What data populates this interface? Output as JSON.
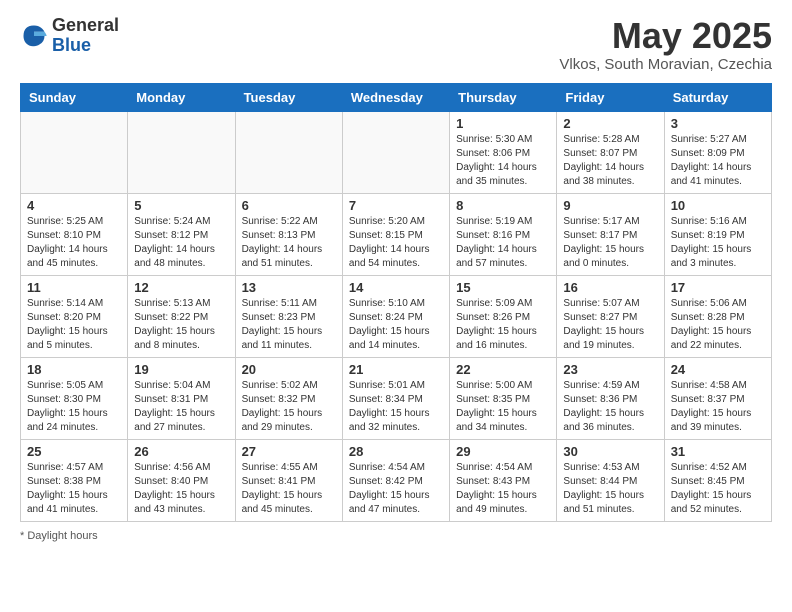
{
  "header": {
    "logo_general": "General",
    "logo_blue": "Blue",
    "month_title": "May 2025",
    "subtitle": "Vlkos, South Moravian, Czechia"
  },
  "days_of_week": [
    "Sunday",
    "Monday",
    "Tuesday",
    "Wednesday",
    "Thursday",
    "Friday",
    "Saturday"
  ],
  "weeks": [
    [
      {
        "day": "",
        "sunrise": "",
        "sunset": "",
        "daylight": "",
        "empty": true
      },
      {
        "day": "",
        "sunrise": "",
        "sunset": "",
        "daylight": "",
        "empty": true
      },
      {
        "day": "",
        "sunrise": "",
        "sunset": "",
        "daylight": "",
        "empty": true
      },
      {
        "day": "",
        "sunrise": "",
        "sunset": "",
        "daylight": "",
        "empty": true
      },
      {
        "day": "1",
        "sunrise": "Sunrise: 5:30 AM",
        "sunset": "Sunset: 8:06 PM",
        "daylight": "Daylight: 14 hours and 35 minutes."
      },
      {
        "day": "2",
        "sunrise": "Sunrise: 5:28 AM",
        "sunset": "Sunset: 8:07 PM",
        "daylight": "Daylight: 14 hours and 38 minutes."
      },
      {
        "day": "3",
        "sunrise": "Sunrise: 5:27 AM",
        "sunset": "Sunset: 8:09 PM",
        "daylight": "Daylight: 14 hours and 41 minutes."
      }
    ],
    [
      {
        "day": "4",
        "sunrise": "Sunrise: 5:25 AM",
        "sunset": "Sunset: 8:10 PM",
        "daylight": "Daylight: 14 hours and 45 minutes."
      },
      {
        "day": "5",
        "sunrise": "Sunrise: 5:24 AM",
        "sunset": "Sunset: 8:12 PM",
        "daylight": "Daylight: 14 hours and 48 minutes."
      },
      {
        "day": "6",
        "sunrise": "Sunrise: 5:22 AM",
        "sunset": "Sunset: 8:13 PM",
        "daylight": "Daylight: 14 hours and 51 minutes."
      },
      {
        "day": "7",
        "sunrise": "Sunrise: 5:20 AM",
        "sunset": "Sunset: 8:15 PM",
        "daylight": "Daylight: 14 hours and 54 minutes."
      },
      {
        "day": "8",
        "sunrise": "Sunrise: 5:19 AM",
        "sunset": "Sunset: 8:16 PM",
        "daylight": "Daylight: 14 hours and 57 minutes."
      },
      {
        "day": "9",
        "sunrise": "Sunrise: 5:17 AM",
        "sunset": "Sunset: 8:17 PM",
        "daylight": "Daylight: 15 hours and 0 minutes."
      },
      {
        "day": "10",
        "sunrise": "Sunrise: 5:16 AM",
        "sunset": "Sunset: 8:19 PM",
        "daylight": "Daylight: 15 hours and 3 minutes."
      }
    ],
    [
      {
        "day": "11",
        "sunrise": "Sunrise: 5:14 AM",
        "sunset": "Sunset: 8:20 PM",
        "daylight": "Daylight: 15 hours and 5 minutes."
      },
      {
        "day": "12",
        "sunrise": "Sunrise: 5:13 AM",
        "sunset": "Sunset: 8:22 PM",
        "daylight": "Daylight: 15 hours and 8 minutes."
      },
      {
        "day": "13",
        "sunrise": "Sunrise: 5:11 AM",
        "sunset": "Sunset: 8:23 PM",
        "daylight": "Daylight: 15 hours and 11 minutes."
      },
      {
        "day": "14",
        "sunrise": "Sunrise: 5:10 AM",
        "sunset": "Sunset: 8:24 PM",
        "daylight": "Daylight: 15 hours and 14 minutes."
      },
      {
        "day": "15",
        "sunrise": "Sunrise: 5:09 AM",
        "sunset": "Sunset: 8:26 PM",
        "daylight": "Daylight: 15 hours and 16 minutes."
      },
      {
        "day": "16",
        "sunrise": "Sunrise: 5:07 AM",
        "sunset": "Sunset: 8:27 PM",
        "daylight": "Daylight: 15 hours and 19 minutes."
      },
      {
        "day": "17",
        "sunrise": "Sunrise: 5:06 AM",
        "sunset": "Sunset: 8:28 PM",
        "daylight": "Daylight: 15 hours and 22 minutes."
      }
    ],
    [
      {
        "day": "18",
        "sunrise": "Sunrise: 5:05 AM",
        "sunset": "Sunset: 8:30 PM",
        "daylight": "Daylight: 15 hours and 24 minutes."
      },
      {
        "day": "19",
        "sunrise": "Sunrise: 5:04 AM",
        "sunset": "Sunset: 8:31 PM",
        "daylight": "Daylight: 15 hours and 27 minutes."
      },
      {
        "day": "20",
        "sunrise": "Sunrise: 5:02 AM",
        "sunset": "Sunset: 8:32 PM",
        "daylight": "Daylight: 15 hours and 29 minutes."
      },
      {
        "day": "21",
        "sunrise": "Sunrise: 5:01 AM",
        "sunset": "Sunset: 8:34 PM",
        "daylight": "Daylight: 15 hours and 32 minutes."
      },
      {
        "day": "22",
        "sunrise": "Sunrise: 5:00 AM",
        "sunset": "Sunset: 8:35 PM",
        "daylight": "Daylight: 15 hours and 34 minutes."
      },
      {
        "day": "23",
        "sunrise": "Sunrise: 4:59 AM",
        "sunset": "Sunset: 8:36 PM",
        "daylight": "Daylight: 15 hours and 36 minutes."
      },
      {
        "day": "24",
        "sunrise": "Sunrise: 4:58 AM",
        "sunset": "Sunset: 8:37 PM",
        "daylight": "Daylight: 15 hours and 39 minutes."
      }
    ],
    [
      {
        "day": "25",
        "sunrise": "Sunrise: 4:57 AM",
        "sunset": "Sunset: 8:38 PM",
        "daylight": "Daylight: 15 hours and 41 minutes."
      },
      {
        "day": "26",
        "sunrise": "Sunrise: 4:56 AM",
        "sunset": "Sunset: 8:40 PM",
        "daylight": "Daylight: 15 hours and 43 minutes."
      },
      {
        "day": "27",
        "sunrise": "Sunrise: 4:55 AM",
        "sunset": "Sunset: 8:41 PM",
        "daylight": "Daylight: 15 hours and 45 minutes."
      },
      {
        "day": "28",
        "sunrise": "Sunrise: 4:54 AM",
        "sunset": "Sunset: 8:42 PM",
        "daylight": "Daylight: 15 hours and 47 minutes."
      },
      {
        "day": "29",
        "sunrise": "Sunrise: 4:54 AM",
        "sunset": "Sunset: 8:43 PM",
        "daylight": "Daylight: 15 hours and 49 minutes."
      },
      {
        "day": "30",
        "sunrise": "Sunrise: 4:53 AM",
        "sunset": "Sunset: 8:44 PM",
        "daylight": "Daylight: 15 hours and 51 minutes."
      },
      {
        "day": "31",
        "sunrise": "Sunrise: 4:52 AM",
        "sunset": "Sunset: 8:45 PM",
        "daylight": "Daylight: 15 hours and 52 minutes."
      }
    ]
  ],
  "footer": {
    "daylight_label": "Daylight hours"
  }
}
